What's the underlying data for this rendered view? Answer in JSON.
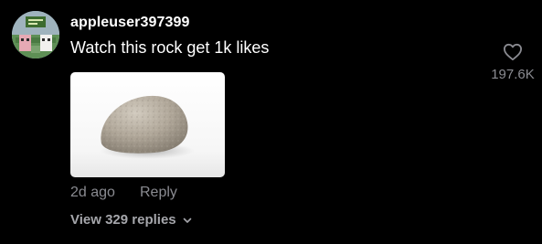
{
  "comment": {
    "username": "appleuser397399",
    "text": "Watch this rock get 1k likes",
    "timestamp": "2d ago",
    "reply_label": "Reply",
    "view_replies_label": "View 329 replies",
    "like_count": "197.6K",
    "icons": {
      "like": "heart-outline-icon",
      "expand": "chevron-down-icon"
    }
  },
  "colors": {
    "background": "#000000",
    "primary_text": "#ffffff",
    "secondary_text": "#8a8b91"
  }
}
